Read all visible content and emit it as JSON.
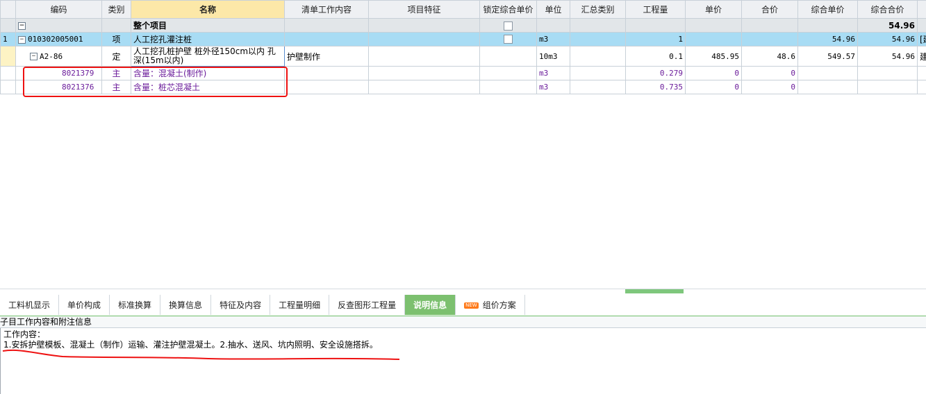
{
  "columns": [
    "编码",
    "类别",
    "名称",
    "清单工作内容",
    "项目特征",
    "锁定综合单价",
    "单位",
    "汇总类别",
    "工程量",
    "单价",
    "合价",
    "综合单价",
    "综合合价",
    ""
  ],
  "total_row": {
    "name": "整个项目",
    "total": "54.96"
  },
  "item_row": {
    "seq": "1",
    "code": "010302005001",
    "type": "项",
    "name": "人工挖孔灌注桩",
    "unit": "m3",
    "qty": "1",
    "unit_price": "54.96",
    "total": "54.96",
    "extra": "[建"
  },
  "quota_row": {
    "code": "A2-86",
    "type": "定",
    "name": "人工挖孔桩护壁 桩外径150cm以内 孔深(15m以内)",
    "work": "护壁制作",
    "unit": "10m3",
    "qty": "0.1",
    "price": "485.95",
    "sum": "48.6",
    "unit_price": "549.57",
    "total": "54.96",
    "extra": "建"
  },
  "sub_rows": [
    {
      "code": "8021379",
      "type": "主",
      "name": "含量：混凝土(制作)",
      "unit": "m3",
      "qty": "0.279",
      "price": "0",
      "sum": "0"
    },
    {
      "code": "8021376",
      "type": "主",
      "name": "含量：桩芯混凝土",
      "unit": "m3",
      "qty": "0.735",
      "price": "0",
      "sum": "0"
    }
  ],
  "tabs": [
    "工料机显示",
    "单价构成",
    "标准换算",
    "换算信息",
    "特征及内容",
    "工程量明细",
    "反查图形工程量",
    "说明信息",
    "组价方案"
  ],
  "new_badge": "NEW",
  "panel": {
    "title": "子目工作内容和附注信息",
    "label": "工作内容：",
    "content": "1.安拆护壁模板、混凝土（制作）运输、灌注护壁混凝土。2.抽水、送风、坑内照明、安全设施搭拆。"
  },
  "colors": {
    "accent_tab": "#7cc06f",
    "selected_row": "#a8dcf4",
    "header_highlight": "#fce8a8",
    "sub_text": "#6a1b9a",
    "annotation": "#e11"
  }
}
